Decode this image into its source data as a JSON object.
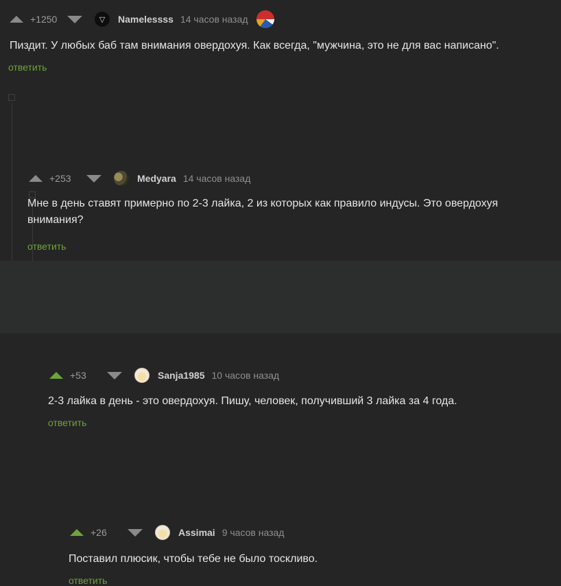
{
  "comments": [
    {
      "rating": "+1250",
      "username": "Namelessss",
      "time": "14 часов назад",
      "avatar_icon": "triangle-down-icon",
      "text": "Пиздит. У любых баб там внимания овердохуя. Как всегда, \"мужчина, это не для вас написано\".",
      "reply_label": "ответить"
    },
    {
      "rating": "+253",
      "username": "Medyara",
      "time": "14 часов назад",
      "text": "Мне в день ставят примерно по 2-3 лайка, 2 из которых как правило индусы. Это овердохуя внимания?",
      "reply_label": "ответить"
    },
    {
      "rating": "+53",
      "username": "Sanja1985",
      "time": "10 часов назад",
      "text": "2-3 лайка в день - это овердохуя. Пишу, человек, получивший 3 лайка за 4 года.",
      "reply_label": "ответить"
    },
    {
      "rating": "+26",
      "username": "Assimai",
      "time": "9 часов назад",
      "text": "Поставил плюсик, чтобы тебе не было тоскливо.",
      "reply_label": "ответить"
    }
  ],
  "colors": {
    "background": "#252525",
    "highlight_background": "#2c2e2d",
    "accent_green": "#6ea33c",
    "text": "#e6e6e6",
    "muted": "#8f8f8f"
  }
}
